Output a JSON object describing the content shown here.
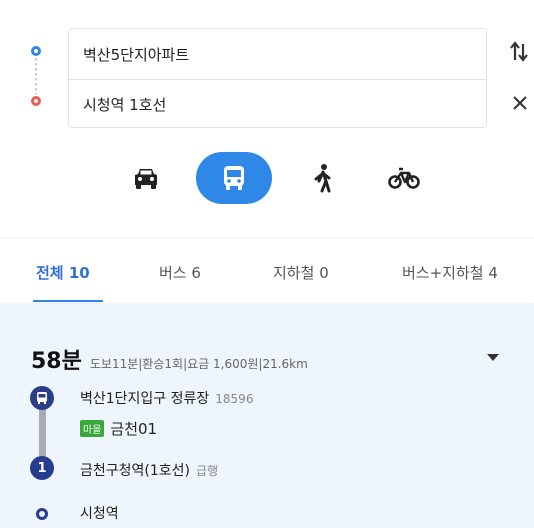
{
  "route": {
    "origin": "벽산5단지아파트",
    "destination": "시청역 1호선",
    "swap_icon": "swap-vertical-icon",
    "clear_icon": "close-icon"
  },
  "modes": [
    {
      "name": "car",
      "icon": "car-icon",
      "active": false
    },
    {
      "name": "bus",
      "icon": "bus-icon",
      "active": true
    },
    {
      "name": "walk",
      "icon": "walk-icon",
      "active": false
    },
    {
      "name": "bike",
      "icon": "bicycle-icon",
      "active": false
    }
  ],
  "tabs": [
    {
      "label": "전체",
      "count": "10",
      "active": true
    },
    {
      "label": "버스",
      "count": "6",
      "active": false
    },
    {
      "label": "지하철",
      "count": "0",
      "active": false
    },
    {
      "label": "버스+지하철",
      "count": "4",
      "active": false
    }
  ],
  "result": {
    "duration": "58분",
    "walk": "도보11분",
    "transfers": "환승1회",
    "fare": "요금 1,600원",
    "distance": "21.6km",
    "steps": {
      "start_stop": "벽산1단지입구 정류장",
      "start_stop_id": "18596",
      "bus_badge": "마을",
      "bus_number": "금천01",
      "subway_line_no": "1",
      "subway_stop": "금천구청역(1호선)",
      "subway_type": "급행",
      "end_stop": "시청역"
    }
  },
  "colors": {
    "accent": "#2f87e8",
    "tab_active": "#2f6fd6",
    "panel_bg": "#eef5fc",
    "subway_line1": "#263c8e",
    "village_bus": "#3aa93a"
  }
}
